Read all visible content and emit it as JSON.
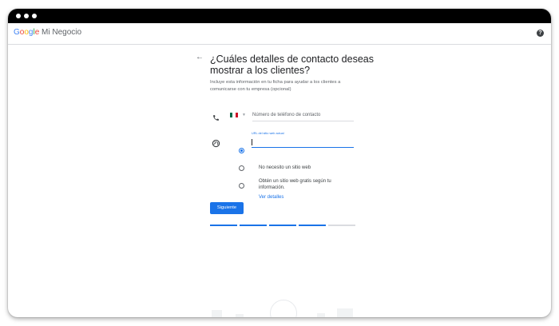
{
  "window": {
    "brand_google_letters": [
      "G",
      "o",
      "o",
      "g",
      "l",
      "e"
    ],
    "brand_suffix": "Mi Negocio",
    "help_icon": "?"
  },
  "colors": {
    "google_letters": [
      "#4285F4",
      "#EA4335",
      "#FBBC05",
      "#4285F4",
      "#34A853",
      "#EA4335"
    ],
    "accent": "#1a73e8",
    "titlebar": "#000000"
  },
  "form": {
    "title": "¿Cuáles detalles de contacto deseas mostrar a los clientes?",
    "subtitle": "Incluye esta información en tu ficha para ayudar a los clientes a comunicarse con tu empresa (opcional)",
    "phone": {
      "icon": "phone-icon",
      "country_flag": "mexico-flag-icon",
      "placeholder": "Número de teléfono de contacto",
      "value": ""
    },
    "website": {
      "icon": "globe-icon",
      "field_label": "URL del sitio web actual",
      "value": "",
      "options": [
        {
          "label": "No necesito un sitio web",
          "selected": false
        },
        {
          "label": "Obtén un sitio web gratis según tu información.",
          "selected": false,
          "link": "Ver detalles"
        }
      ]
    },
    "next_button": "Siguiente",
    "progress": {
      "steps_total": 5,
      "steps_completed": 4
    }
  }
}
